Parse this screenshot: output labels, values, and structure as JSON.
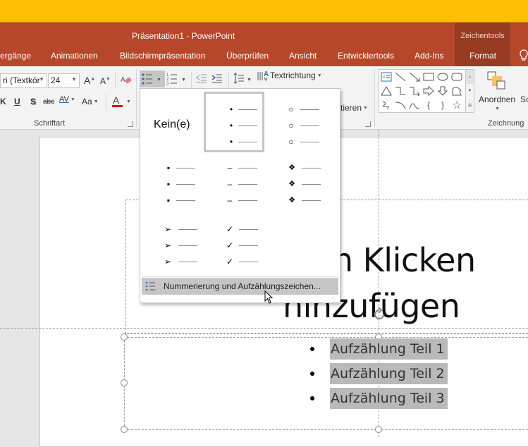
{
  "window": {
    "title": "Präsentation1 - PowerPoint",
    "contextual_group": "Zeichentools",
    "accent_color": "#b7472a",
    "topbar_color": "#fdbd00"
  },
  "tabs": [
    {
      "label": "ergänge"
    },
    {
      "label": "Animationen"
    },
    {
      "label": "Bildschirmpräsentation"
    },
    {
      "label": "Überprüfen"
    },
    {
      "label": "Ansicht"
    },
    {
      "label": "Entwicklertools"
    },
    {
      "label": "Add-Ins"
    },
    {
      "label": "Format",
      "contextual": true
    }
  ],
  "ribbon": {
    "font_group": {
      "label": "Schriftart",
      "font_name": "ri (Textkör",
      "font_size": "24",
      "underline": "U",
      "shadow": "S",
      "strikethrough": "abc",
      "spacing": "AV",
      "change_case": "Aa",
      "font_color_accent": "#e00000"
    },
    "paragraph_group": {
      "text_direction": "Textrichtung",
      "align_partial": "tieren"
    },
    "drawing_group": {
      "label": "Zeichnung",
      "arrange": "Anordnen",
      "quick_styles_partial": "Sc"
    }
  },
  "bullet_dropdown": {
    "none_label": "Kein(e)",
    "styles": [
      {
        "name": "none",
        "glyph": ""
      },
      {
        "name": "filled-round",
        "glyph": "•",
        "selected": true
      },
      {
        "name": "hollow-round",
        "glyph": "○"
      },
      {
        "name": "filled-square",
        "glyph": "▪"
      },
      {
        "name": "dash",
        "glyph": "–"
      },
      {
        "name": "four-diamond",
        "glyph": "❖"
      },
      {
        "name": "arrow",
        "glyph": "➢"
      },
      {
        "name": "checkmark",
        "glyph": "✓"
      }
    ],
    "footer_label": "Nummerierung und Aufzählungszeichen..."
  },
  "slide": {
    "title_line1": "urch Klicken",
    "title_line2": "hinzufügen",
    "bullets": [
      "Aufzählung Teil 1",
      "Aufzählung Teil 2",
      "Aufzählung Teil 3"
    ]
  }
}
